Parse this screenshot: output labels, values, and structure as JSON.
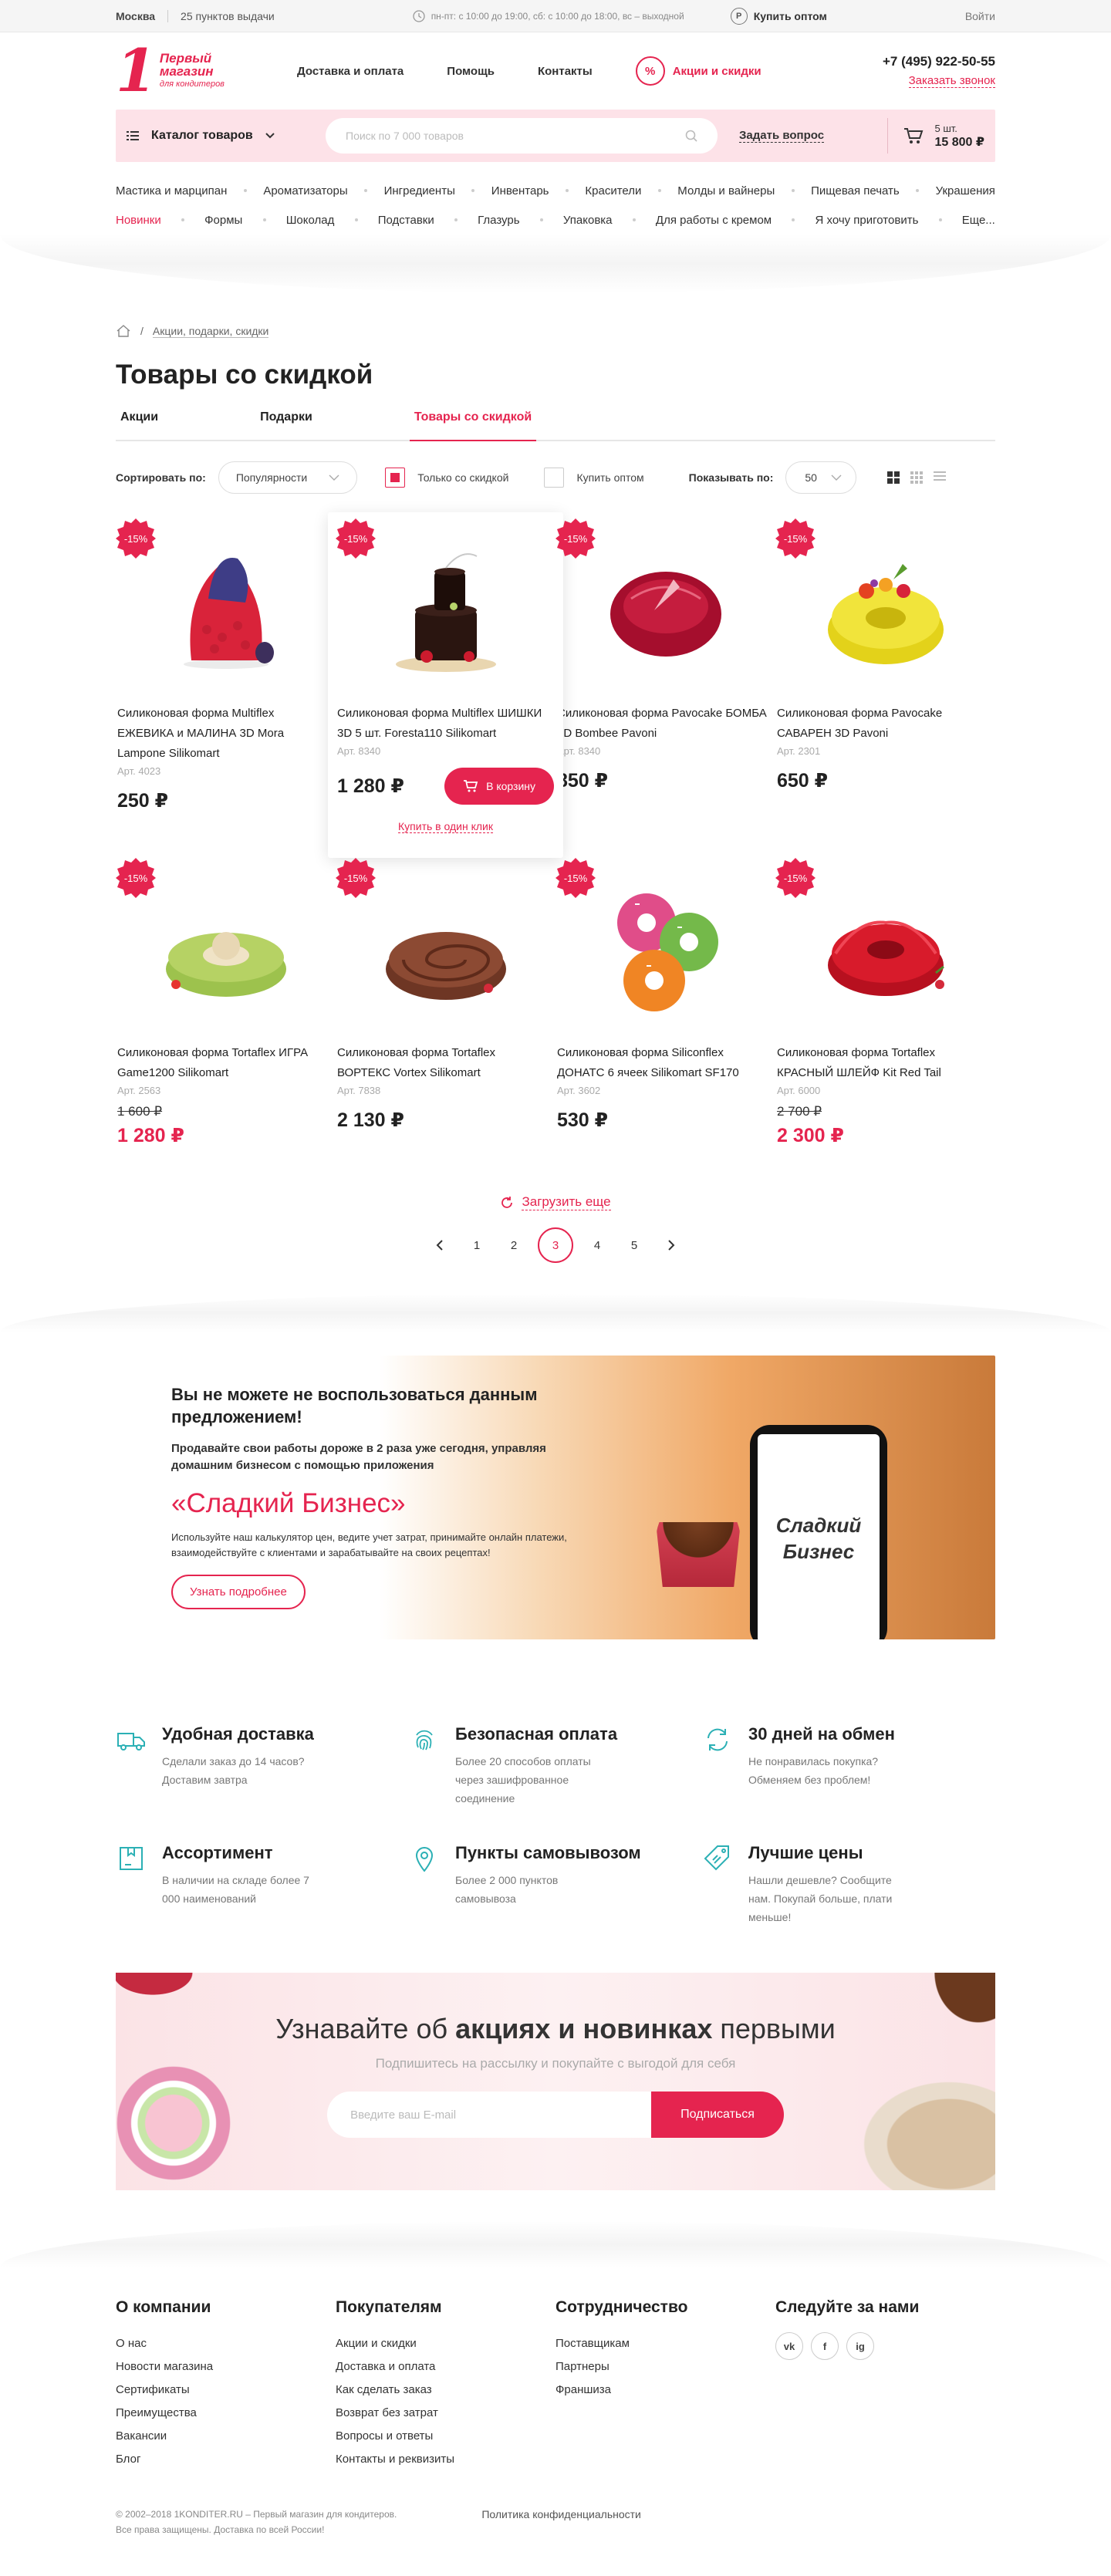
{
  "topbar": {
    "city": "Москва",
    "pickup": "25 пунктов выдачи",
    "hours": "пн-пт: с 10:00 до 19:00, сб: с 10:00 до 18:00, вс – выходной",
    "wholesale": "Купить оптом",
    "wholesale_icon": "Р",
    "login": "Войти"
  },
  "header": {
    "logo_digit": "1",
    "logo_line1": "Первый",
    "logo_line2": "магазин",
    "logo_line3": "для кондитеров",
    "nav": [
      "Доставка и оплата",
      "Помощь",
      "Контакты"
    ],
    "promo": "Акции и скидки",
    "phone": "+7 (495) 922-50-55",
    "callback": "Заказать звонок"
  },
  "searchbar": {
    "catalog": "Каталог товаров",
    "placeholder": "Поиск по 7 000 товаров",
    "ask": "Задать вопрос",
    "cart_count": "5 шт.",
    "cart_sum": "15 800 ₽"
  },
  "categories": {
    "row1": [
      "Мастика и марципан",
      "Ароматизаторы",
      "Ингредиенты",
      "Инвентарь",
      "Красители",
      "Молды и вайнеры",
      "Пищевая печать",
      "Украшения"
    ],
    "row2": [
      "Новинки",
      "Формы",
      "Шоколад",
      "Подставки",
      "Глазурь",
      "Упаковка",
      "Для работы с кремом",
      "Я хочу приготовить",
      "Еще..."
    ]
  },
  "breadcrumb": {
    "current": "Акции, подарки, скидки"
  },
  "page": {
    "title": "Товары со скидкой",
    "tabs": [
      "Акции",
      "Подарки",
      "Товары со скидкой"
    ]
  },
  "filters": {
    "sort_label": "Сортировать по:",
    "sort_value": "Популярности",
    "only_discount": "Только со скидкой",
    "only_discount_checked": true,
    "wholesale": "Купить оптом",
    "wholesale_checked": false,
    "show_label": "Показывать по:",
    "show_value": "50"
  },
  "products": [
    {
      "badge": "-15%",
      "name": "Силиконовая форма Multiflex ЕЖЕВИКА и МАЛИНА 3D Mora Lampone Silikomart",
      "art": "Арт. 4023",
      "price": "250 ₽",
      "old": "",
      "img": "berry"
    },
    {
      "badge": "-15%",
      "name": "Силиконовая форма Multiflex ШИШКИ 3D 5 шт. Foresta110 Silikomart",
      "art": "Арт. 8340",
      "price": "1 280 ₽",
      "old": "",
      "img": "choc",
      "cart_btn": "В корзину",
      "oneclick": "Купить в один клик"
    },
    {
      "badge": "-15%",
      "name": "Силиконовая форма Pavocake БОМБА 3D Bombee Pavoni",
      "art": "Арт. 8340",
      "price": "850 ₽",
      "old": "",
      "img": "bomb"
    },
    {
      "badge": "-15%",
      "name": "Силиконовая форма Pavocake САВАРЕН 3D Pavoni",
      "art": "Арт. 2301",
      "price": "650 ₽",
      "old": "",
      "img": "savarin"
    },
    {
      "badge": "-15%",
      "name": "Силиконовая форма Tortaflex ИГРА Game1200 Silikomart",
      "art": "Арт. 2563",
      "price": "1 280 ₽",
      "old": "1 600 ₽",
      "img": "game"
    },
    {
      "badge": "-15%",
      "name": "Силиконовая форма Tortaflex ВОРТЕКС Vortex Silikomart",
      "art": "Арт. 7838",
      "price": "2 130 ₽",
      "old": "",
      "img": "vortex"
    },
    {
      "badge": "-15%",
      "name": "Силиконовая форма Siliconflex ДОНАТС 6 ячеек Silikomart SF170",
      "art": "Арт. 3602",
      "price": "530 ₽",
      "old": "",
      "img": "donut"
    },
    {
      "badge": "-15%",
      "name": "Силиконовая форма Tortaflex КРАСНЫЙ ШЛЕЙФ Kit Red Tail",
      "art": "Арт. 6000",
      "price": "2 300 ₽",
      "old": "2 700 ₽",
      "img": "redtail"
    }
  ],
  "load_more": "Загрузить еще",
  "pager": {
    "pages": [
      "1",
      "2",
      "3",
      "4",
      "5"
    ],
    "current": "3"
  },
  "banner": {
    "heading": "Вы не можете не воспользоваться данным предложением!",
    "text": "Продавайте свои работы дороже в 2 раза уже сегодня, управляя домашним бизнесом с помощью приложения",
    "title": "«Сладкий Бизнес»",
    "desc": "Используйте наш калькулятор цен, ведите учет затрат, принимайте онлайн платежи, взаимодействуйте с клиентами и зарабатывайте на своих рецептах!",
    "button": "Узнать подробнее",
    "phone_line1": "Сладкий",
    "phone_line2": "Бизнес"
  },
  "benefits": [
    {
      "icon": "truck-icon",
      "title": "Удобная доставка",
      "text": "Сделали заказ до 14 часов? Доставим завтра"
    },
    {
      "icon": "fingerprint-icon",
      "title": "Безопасная оплата",
      "text": "Более 20 способов оплаты через зашифрованное соединение"
    },
    {
      "icon": "exchange-icon",
      "title": "30 дней на обмен",
      "text": "Не понравилась покупка? Обменяем без проблем!"
    },
    {
      "icon": "box-icon",
      "title": "Ассортимент",
      "text": "В наличии на складе более 7 000 наименований"
    },
    {
      "icon": "pin-icon",
      "title": "Пункты самовывозом",
      "text": "Более 2 000 пунктов самовывоза"
    },
    {
      "icon": "tag-icon",
      "title": "Лучшие цены",
      "text": "Нашли дешевле? Сообщите нам. Покупай больше, плати меньше!"
    }
  ],
  "subscribe": {
    "title_pre": "Узнавайте об ",
    "title_bold": "акциях и новинках",
    "title_post": " первыми",
    "subtitle": "Подпишитесь на рассылку и покупайте с выгодой для себя",
    "placeholder": "Введите ваш E-mail",
    "button": "Подписаться"
  },
  "footer": {
    "cols": [
      {
        "title": "О компании",
        "links": [
          "О нас",
          "Новости магазина",
          "Сертификаты",
          "Преимущества",
          "Вакансии",
          "Блог"
        ]
      },
      {
        "title": "Покупателям",
        "links": [
          "Акции и скидки",
          "Доставка и оплата",
          "Как сделать заказ",
          "Возврат без затрат",
          "Вопросы и ответы",
          "Контакты и реквизиты"
        ]
      },
      {
        "title": "Сотрудничество",
        "links": [
          "Поставщикам",
          "Партнеры",
          "Франшиза"
        ]
      }
    ],
    "social_title": "Следуйте за нами",
    "social": [
      "vk",
      "f",
      "ig"
    ],
    "copy1": "© 2002–2018 1KONDITER.RU – Первый магазин для кондитеров.",
    "copy2": "Все права защищены. Доставка по всей России!",
    "policy": "Политика конфиденциальности"
  },
  "colors": {
    "accent": "#e5244f",
    "pink_bg": "#fde2e8"
  }
}
